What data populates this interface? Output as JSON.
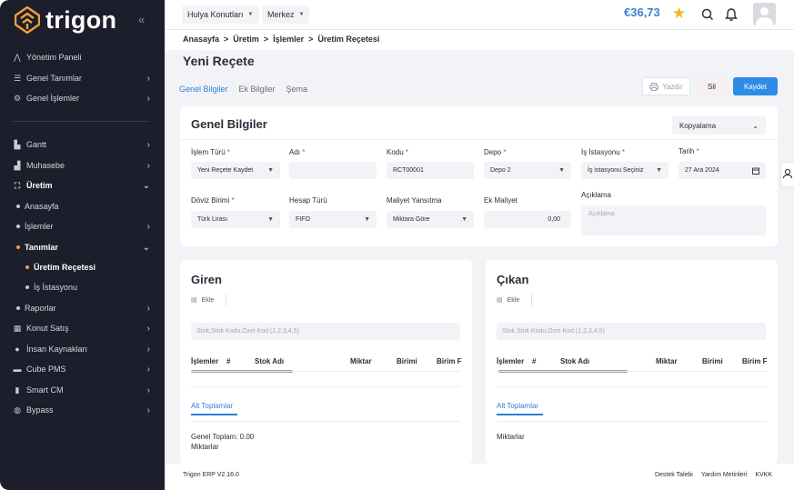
{
  "brand": {
    "name": "trigon"
  },
  "sidebar": {
    "items": [
      {
        "label": "Yönetim Paneli",
        "icon": "chart-line-icon",
        "chevron": false
      },
      {
        "label": "Genel Tanımlar",
        "icon": "sliders-icon",
        "chevron": true
      },
      {
        "label": "Genel İşlemler",
        "icon": "gears-icon",
        "chevron": true
      },
      {
        "label": "Gantt",
        "icon": "chart-bar-icon",
        "chevron": true
      },
      {
        "label": "Muhasebe",
        "icon": "bank-icon",
        "chevron": true
      },
      {
        "label": "Üretim",
        "icon": "sitemap-icon",
        "chevron": true,
        "open": true
      },
      {
        "label": "Anasayfa"
      },
      {
        "label": "İşlemler",
        "chevron": true
      },
      {
        "label": "Tanımlar",
        "chevron": true,
        "open": true
      },
      {
        "label": "Üretim Reçetesi"
      },
      {
        "label": "İş İstasyonu"
      },
      {
        "label": "Raporlar",
        "chevron": true
      },
      {
        "label": "Konut Satış",
        "icon": "building-icon",
        "chevron": true
      },
      {
        "label": "İnsan Kaynakları",
        "icon": "user-icon",
        "chevron": true
      },
      {
        "label": "Cube PMS",
        "icon": "cube-icon",
        "chevron": true
      },
      {
        "label": "Smart CM",
        "icon": "file-icon",
        "chevron": true
      },
      {
        "label": "Bypass",
        "icon": "globe-icon",
        "chevron": true
      }
    ]
  },
  "topbar": {
    "company": "Hulya Konutları",
    "branch": "Merkez",
    "balance": "€36,73"
  },
  "breadcrumb": [
    "Anasayfa",
    ">",
    "Üretim",
    ">",
    "İşlemler",
    ">",
    "Üretim Reçetesi"
  ],
  "page": {
    "title": "Yeni Reçete",
    "tabs": [
      "Genel Bilgiler",
      "Ek Bilgiler",
      "Şema"
    ],
    "actions": {
      "print": "Yazdır",
      "delete": "Sil",
      "save": "Kaydet"
    }
  },
  "general": {
    "title": "Genel Bilgiler",
    "copy_select": "Kopyalama",
    "fields": {
      "islem_turu": {
        "label": "İşlem Türü",
        "value": "Yeni Reçete Kaydet"
      },
      "adi": {
        "label": "Adı",
        "value": ""
      },
      "kodu": {
        "label": "Kodu",
        "value": "RCT00001"
      },
      "depo": {
        "label": "Depo",
        "value": "Depo 2"
      },
      "is_istasyonu": {
        "label": "İş İstasyonu",
        "value": "İş istasyonu Seçiniz"
      },
      "tarih": {
        "label": "Tarih",
        "value": "27  Ara  2024"
      },
      "doviz": {
        "label": "Döviz Birimi",
        "value": "Türk Lirası"
      },
      "hesap_turu": {
        "label": "Hesap Türü",
        "value": "FIFO"
      },
      "maliyet_yansitma": {
        "label": "Maliyet Yansıtma",
        "value": "Miktara Göre"
      },
      "ek_maliyet": {
        "label": "Ek Maliyet",
        "value": "0,00"
      },
      "aciklama": {
        "label": "Açıklama",
        "placeholder": "Açıklama"
      }
    },
    "required_mark": "*"
  },
  "giren": {
    "title": "Giren",
    "add": "Ekle",
    "search_placeholder": "Stok,Stok Kodu,Özel Kod (1,2,3,4,5)",
    "columns": [
      "İşlemler",
      "#",
      "Stok Adı",
      "Miktar",
      "Birimi",
      "Birim F"
    ],
    "subtotal_tab": "Alt Toplamlar",
    "total": "Genel Toplam: 0.00",
    "quantities": "Miktarlar"
  },
  "cikan": {
    "title": "Çıkan",
    "add": "Ekle",
    "search_placeholder": "Stok,Stok Kodu,Özel Kod (1,2,3,4,5)",
    "columns": [
      "İşlemler",
      "#",
      "Stok Adı",
      "Miktar",
      "Birimi",
      "Birim F"
    ],
    "subtotal_tab": "Alt Toplamlar",
    "quantities": "Miktarlar"
  },
  "footer": {
    "version": "Trigon ERP V2.16.0",
    "links": [
      "Destek Talebi",
      "Yardım Metinleri",
      "KVKK"
    ]
  }
}
